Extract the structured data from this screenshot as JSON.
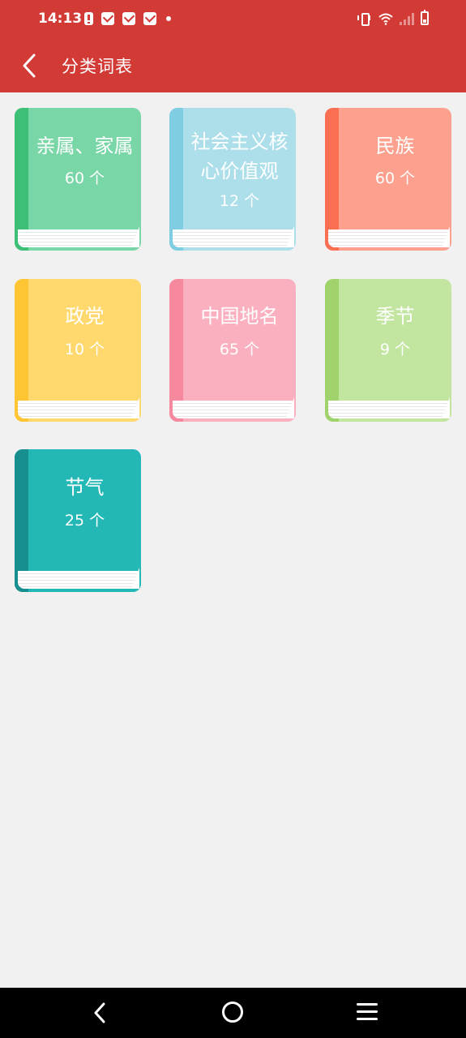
{
  "status_bar": {
    "time": "14:13"
  },
  "header": {
    "title": "分类词表"
  },
  "categories": [
    {
      "title": "亲属、家属",
      "count": "60 个",
      "color": "#79d6a7",
      "spine": "#3dbf78"
    },
    {
      "title": "社会主义核心价值观",
      "title_line1": "社会主义核",
      "title_line2": "心价值观",
      "count": "12 个",
      "color": "#addfeb",
      "spine": "#7ecde2"
    },
    {
      "title": "民族",
      "count": "60 个",
      "color": "#fda08e",
      "spine": "#fb7053"
    },
    {
      "title": "政党",
      "count": "10 个",
      "color": "#ffd96d",
      "spine": "#fec534"
    },
    {
      "title": "中国地名",
      "count": "65 个",
      "color": "#fbb0c0",
      "spine": "#f7899e"
    },
    {
      "title": "季节",
      "count": "9 个",
      "color": "#c2e69f",
      "spine": "#a0d36c"
    },
    {
      "title": "节气",
      "count": "25 个",
      "color": "#23b7b6",
      "spine": "#168f8e"
    }
  ]
}
